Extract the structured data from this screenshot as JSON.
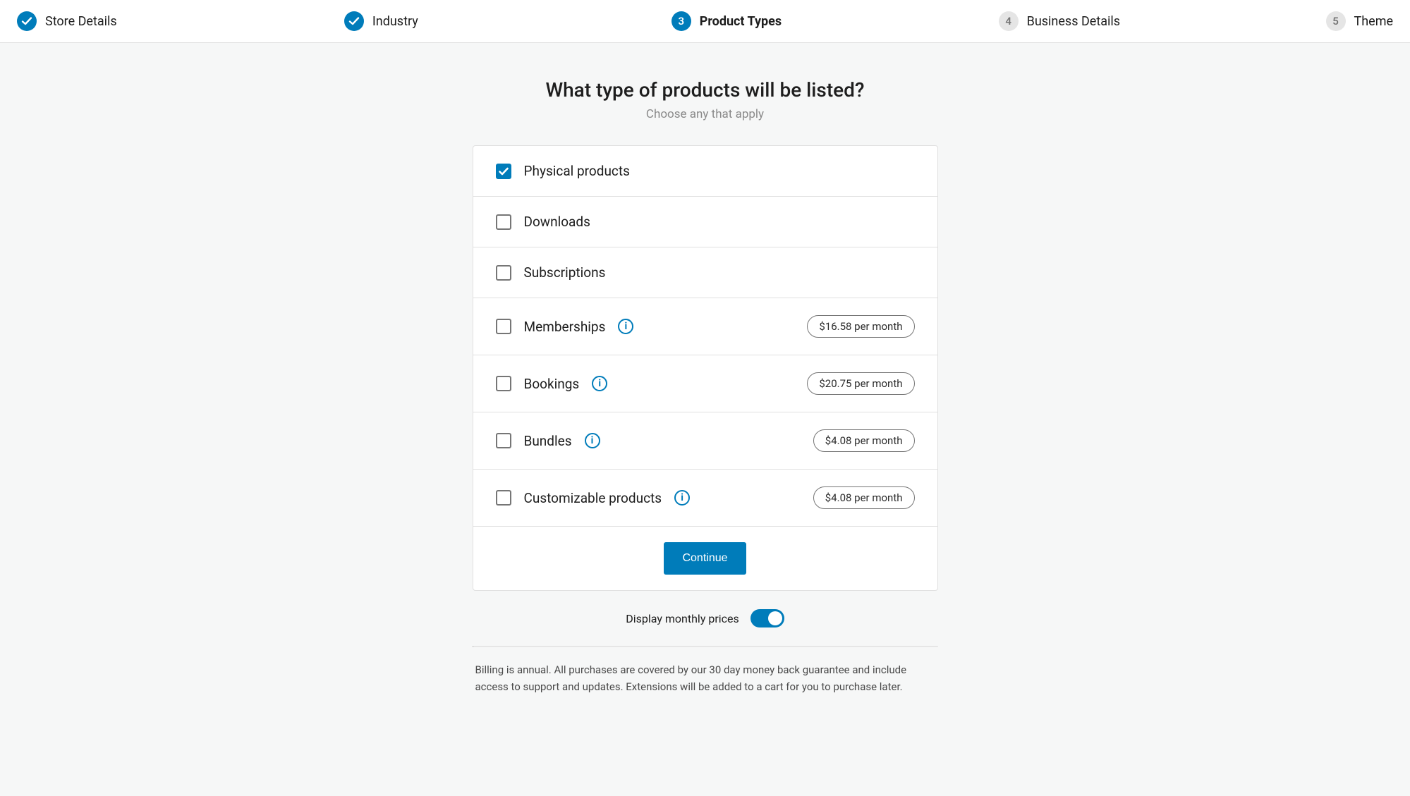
{
  "stepper": {
    "steps": [
      {
        "label": "Store Details",
        "state": "complete",
        "num": ""
      },
      {
        "label": "Industry",
        "state": "complete",
        "num": ""
      },
      {
        "label": "Product Types",
        "state": "active",
        "num": "3"
      },
      {
        "label": "Business Details",
        "state": "pending",
        "num": "4"
      },
      {
        "label": "Theme",
        "state": "pending",
        "num": "5"
      }
    ]
  },
  "heading": "What type of products will be listed?",
  "subheading": "Choose any that apply",
  "options": [
    {
      "label": "Physical products",
      "checked": true,
      "info": false,
      "price": ""
    },
    {
      "label": "Downloads",
      "checked": false,
      "info": false,
      "price": ""
    },
    {
      "label": "Subscriptions",
      "checked": false,
      "info": false,
      "price": ""
    },
    {
      "label": "Memberships",
      "checked": false,
      "info": true,
      "price": "$16.58 per month"
    },
    {
      "label": "Bookings",
      "checked": false,
      "info": true,
      "price": "$20.75 per month"
    },
    {
      "label": "Bundles",
      "checked": false,
      "info": true,
      "price": "$4.08 per month"
    },
    {
      "label": "Customizable products",
      "checked": false,
      "info": true,
      "price": "$4.08 per month"
    }
  ],
  "continue_label": "Continue",
  "toggle": {
    "label": "Display monthly prices",
    "on": true
  },
  "billing_note": "Billing is annual. All purchases are covered by our 30 day money back guarantee and include access to support and updates. Extensions will be added to a cart for you to purchase later."
}
